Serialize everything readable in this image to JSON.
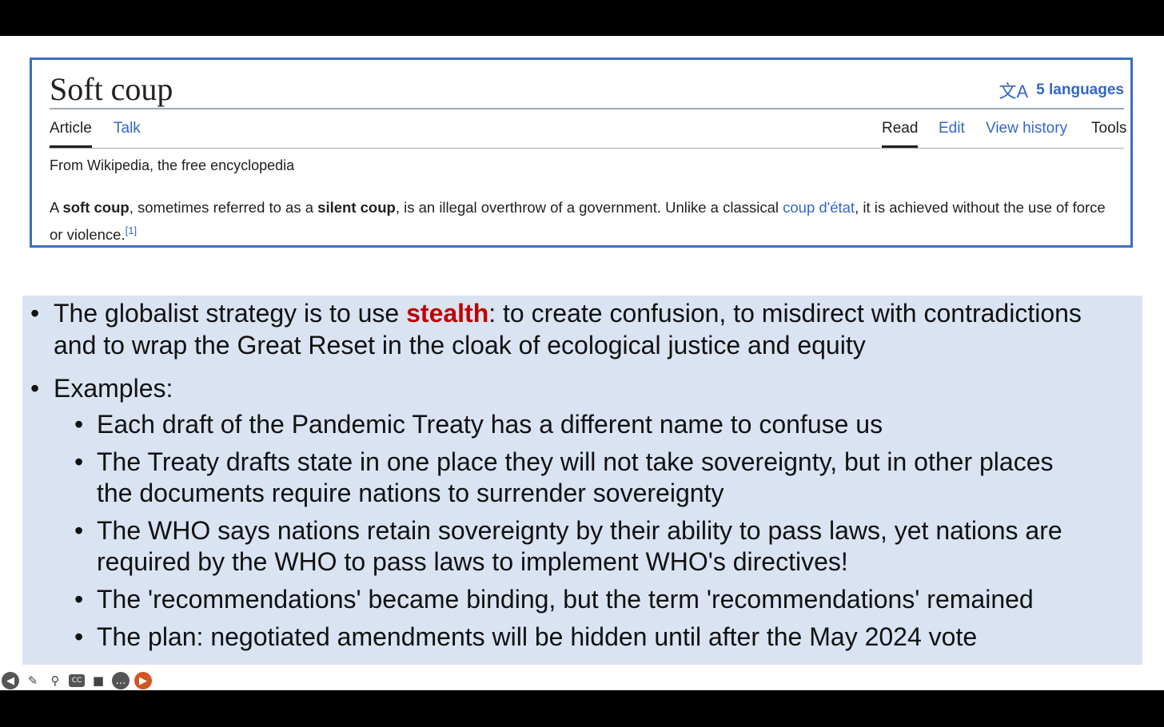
{
  "wiki": {
    "title": "Soft coup",
    "languages": "5 languages",
    "tabs_left": [
      "Article",
      "Talk"
    ],
    "tabs_right": [
      "Read",
      "Edit",
      "View history",
      "Tools"
    ],
    "from": "From Wikipedia, the free encyclopedia",
    "lead": {
      "p1": "A ",
      "b1": "soft coup",
      "p2": ", sometimes referred to as a ",
      "b2": "silent coup",
      "p3": ", is an illegal overthrow of a government. Unlike a classical ",
      "link": "coup d'état",
      "p4": ", it is achieved without the use of force or violence.",
      "ref": "[1]"
    }
  },
  "bullets": {
    "b1_pre": "The globalist strategy is to use ",
    "b1_emph": "stealth",
    "b1_post": ":  to create confusion, to misdirect with contradictions",
    "b1_line2": "and to wrap the Great Reset in the cloak of ecological justice and equity",
    "b2": "Examples:",
    "sub1": "Each draft of the Pandemic Treaty has a different name to confuse us",
    "sub2_l1": "The Treaty drafts state in one place they will not take sovereignty, but in other places",
    "sub2_l2": "the documents require nations to surrender sovereignty",
    "sub3_l1": "The WHO says nations retain sovereignty by their ability to pass laws, yet nations are",
    "sub3_l2": "required by the WHO to pass laws to implement WHO's directives!",
    "sub4": "The 'recommendations' became binding, but the term 'recommendations' remained",
    "sub5": "The plan:  negotiated amendments will be hidden until after the May 2024 vote"
  },
  "toolbar": {
    "icons": [
      "previous-icon",
      "pen-icon",
      "zoom-icon",
      "captions-icon",
      "camera-icon",
      "more-icon",
      "next-icon"
    ],
    "captions_label": "CC"
  }
}
